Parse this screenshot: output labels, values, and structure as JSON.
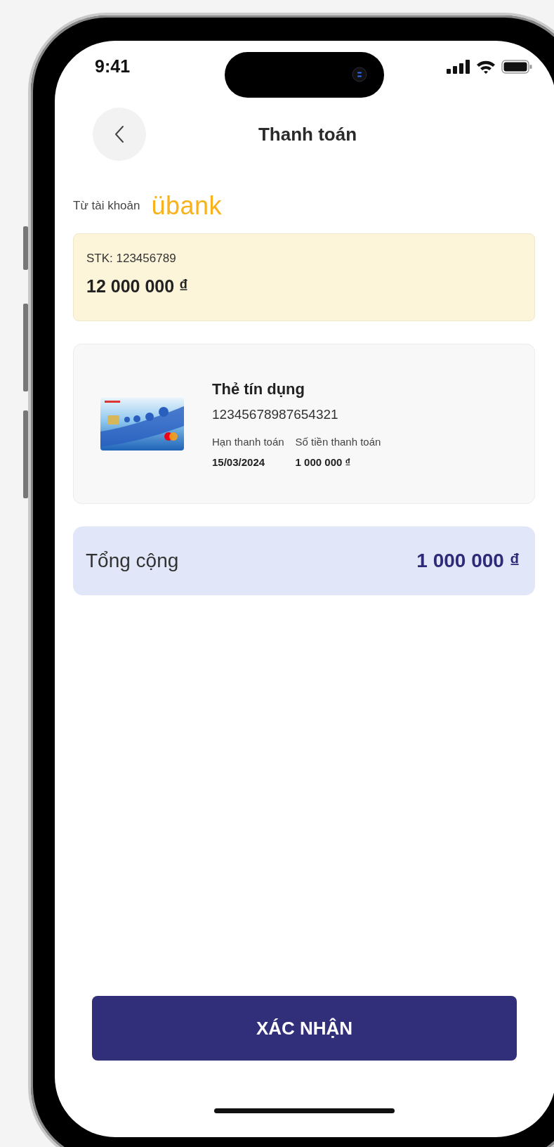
{
  "status_bar": {
    "time": "9:41"
  },
  "header": {
    "title": "Thanh toán"
  },
  "source": {
    "label": "Từ tài khoản",
    "bank_logo": "übank",
    "account_number": "STK: 123456789",
    "balance": "12 000 000 ₫"
  },
  "bill": {
    "title": "Thẻ tín dụng",
    "card_number": "12345678987654321",
    "fields": [
      {
        "label": "Hạn thanh toán",
        "value": "15/03/2024"
      },
      {
        "label": "Số tiền thanh toán",
        "value": "1 000 000 ₫"
      }
    ]
  },
  "total": {
    "label": "Tổng cộng",
    "amount": "1 000 000 ₫"
  },
  "confirm_button": "XÁC NHẬN"
}
